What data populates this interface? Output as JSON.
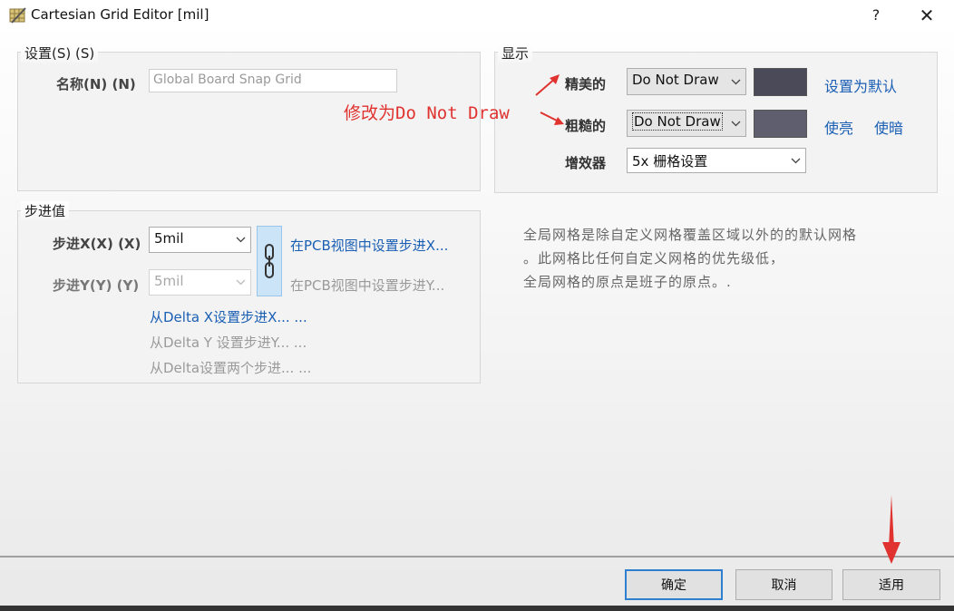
{
  "window": {
    "title": "Cartesian Grid Editor [mil]",
    "help": "?",
    "close": "✕"
  },
  "settings": {
    "group_label": "设置(S) (S)",
    "name_label": "名称(N) (N)",
    "name_value": "Global Board Snap Grid"
  },
  "display": {
    "group_label": "显示",
    "fine_label": "精美的",
    "fine_value": "Do Not Draw",
    "coarse_label": "粗糙的",
    "coarse_value": "Do Not Draw",
    "multiplier_label": "增效器",
    "multiplier_value": "5x 栅格设置",
    "set_default": "设置为默认",
    "lighten": "使亮",
    "darken": "使暗",
    "fine_color": "#4a4a58",
    "coarse_color": "#5e5e6e"
  },
  "annotation": {
    "text": "修改为Do Not Draw",
    "color": "#e0322f"
  },
  "step": {
    "group_label": "步进值",
    "step_x_label": "步进X(X) (X)",
    "step_x_value": "5mil",
    "step_y_label": "步进Y(Y) (Y)",
    "step_y_value": "5mil",
    "set_x_in_pcb": "在PCB视图中设置步进X...",
    "set_y_in_pcb": "在PCB视图中设置步进Y...",
    "from_delta_x": "从Delta X设置步进X... ...",
    "from_delta_y": "从Delta Y 设置步进Y... ...",
    "from_delta_both": "从Delta设置两个步进... ..."
  },
  "description": {
    "line1": "全局网格是除自定义网格覆盖区域以外的的默认网格",
    "line2": "。此网格比任何自定义网格的优先级低，",
    "line3": "全局网格的原点是班子的原点。."
  },
  "buttons": {
    "ok": "确定",
    "cancel": "取消",
    "apply": "适用"
  }
}
